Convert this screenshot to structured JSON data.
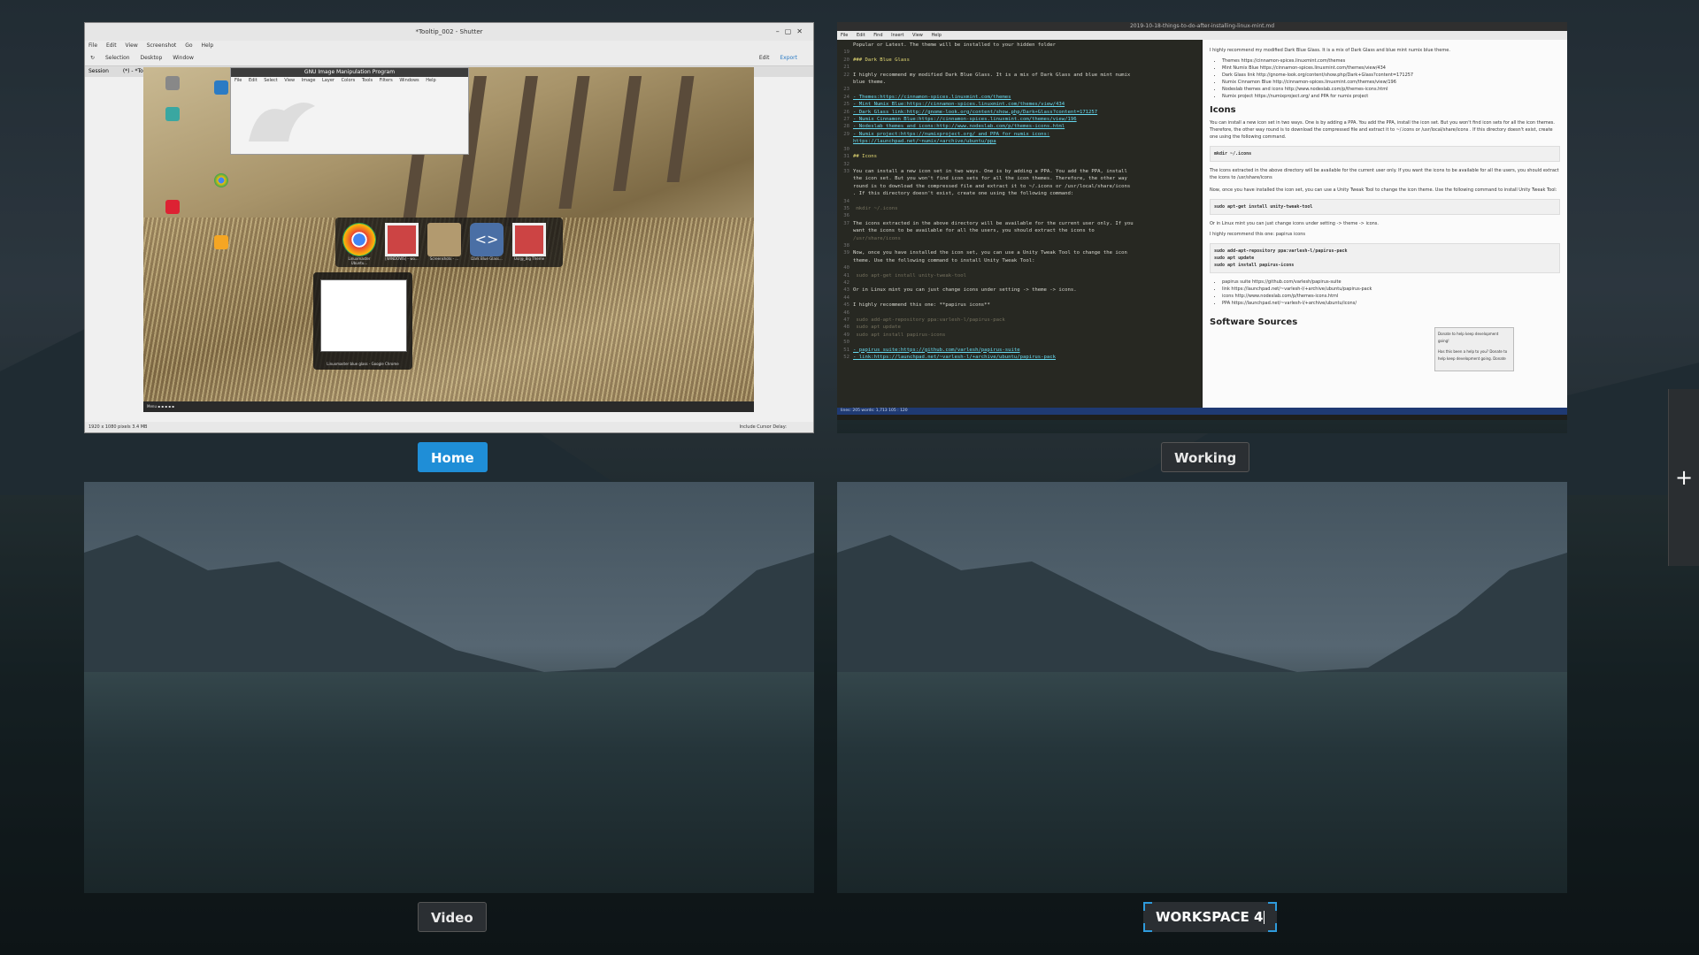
{
  "workspaces": [
    {
      "name": "Home",
      "active": true
    },
    {
      "name": "Working",
      "active": false
    },
    {
      "name": "Video",
      "active": false
    },
    {
      "name": "WORKSPACE 4",
      "active": false,
      "editing": true
    }
  ],
  "add_workspace": {
    "label": "+"
  },
  "shutter": {
    "title": "*Tooltip_002 - Shutter",
    "menu": [
      "File",
      "Edit",
      "View",
      "Screenshot",
      "Go",
      "Help"
    ],
    "toolbar": [
      "Selection",
      "Desktop",
      "Window"
    ],
    "toolbar_right": [
      "Edit",
      "Export"
    ],
    "tabs": [
      "Session",
      "(*) - *Tooltip_002"
    ],
    "status": "1920 x 1080 pixels  3.4 MB",
    "status_right": "Include Cursor  Delay:",
    "gimp_title": "GNU Image Manipulation Program",
    "gimp_menu": [
      "File",
      "Edit",
      "Select",
      "View",
      "Image",
      "Layer",
      "Colors",
      "Tools",
      "Filters",
      "Windows",
      "Help"
    ],
    "dock_items": [
      "Linuxmaster Ubuntu...",
      "[WINDOWS] - wo...",
      "Screenshots - ...",
      "Dark Blue Glass...",
      "Usr@_Big Theme"
    ],
    "preview_label": "Linuxmaster blue glass - Google Chrome"
  },
  "editor": {
    "title": "2019-10-18-things-to-do-after-installing-linux-mint.md",
    "menu": [
      "File",
      "Edit",
      "Find",
      "Insert",
      "View",
      "Help"
    ],
    "code_lines": [
      {
        "n": "",
        "t": "Popular or Latest. The theme will be installed to your hidden folder"
      },
      {
        "n": "19",
        "t": ""
      },
      {
        "n": "20",
        "t": "### Dark Blue Glass",
        "c": "h"
      },
      {
        "n": "21",
        "t": ""
      },
      {
        "n": "22",
        "t": "I highly recommend my modified Dark Blue Glass. It is a mix of Dark Glass and blue mint numix"
      },
      {
        "n": "",
        "t": "blue theme."
      },
      {
        "n": "23",
        "t": ""
      },
      {
        "n": "24",
        "t": "- Themes:https://cinnamon-spices.linuxmint.com/themes",
        "c": "lk"
      },
      {
        "n": "25",
        "t": "- Mint Numix Blue:https://cinnamon-spices.linuxmint.com/themes/view/434",
        "c": "lk"
      },
      {
        "n": "26",
        "t": "- Dark Glass link:http://gnome-look.org/content/show.php/Dark+Glass?content=171257",
        "c": "lk"
      },
      {
        "n": "27",
        "t": "- Numix Cinnamon Blue:https://cinnamon-spices.linuxmint.com/themes/view/196",
        "c": "lk"
      },
      {
        "n": "28",
        "t": "- Nodeslab themes and icons:http://www.nodeslab.com/p/themes-icons.html",
        "c": "lk"
      },
      {
        "n": "29",
        "t": "- Numix project:https://numixproject.org/ and PPA for numix icons:",
        "c": "lk"
      },
      {
        "n": "",
        "t": "https://launchpad.net/~numix/+archive/ubuntu/ppa",
        "c": "lk"
      },
      {
        "n": "30",
        "t": ""
      },
      {
        "n": "31",
        "t": "## Icons",
        "c": "h"
      },
      {
        "n": "32",
        "t": ""
      },
      {
        "n": "33",
        "t": "You can install a new icon set in two ways. One is by adding a PPA. You add the PPA, install"
      },
      {
        "n": "",
        "t": "the icon set. But you won't find icon sets for all the icon themes. Therefore, the other way"
      },
      {
        "n": "",
        "t": "round is to download the compressed file and extract it to ~/.icons or /usr/local/share/icons"
      },
      {
        "n": "",
        "t": ". If this directory doesn't exist, create one using the following command:"
      },
      {
        "n": "34",
        "t": ""
      },
      {
        "n": "35",
        "t": "    mkdir ~/.icons",
        "c": "cm"
      },
      {
        "n": "36",
        "t": ""
      },
      {
        "n": "37",
        "t": "The icons extracted in the above directory will be available for the current user only. If you"
      },
      {
        "n": "",
        "t": "want the icons to be available for all the users, you should extract the icons to"
      },
      {
        "n": "",
        "t": "/usr/share/icons",
        "c": "cm"
      },
      {
        "n": "38",
        "t": ""
      },
      {
        "n": "39",
        "t": "Now, once you have installed the icon set, you can use a Unity Tweak Tool to change the icon"
      },
      {
        "n": "",
        "t": "theme. Use the following command to install Unity Tweak Tool:"
      },
      {
        "n": "40",
        "t": ""
      },
      {
        "n": "41",
        "t": "    sudo apt-get install unity-tweak-tool",
        "c": "cm"
      },
      {
        "n": "42",
        "t": ""
      },
      {
        "n": "43",
        "t": "Or in Linux mint you can just change icons under setting -> theme -> icons."
      },
      {
        "n": "44",
        "t": ""
      },
      {
        "n": "45",
        "t": "I highly recommend this one: **papirus icons**"
      },
      {
        "n": "46",
        "t": ""
      },
      {
        "n": "47",
        "t": "    sudo add-apt-repository ppa:varlesh-l/papirus-pack",
        "c": "cm"
      },
      {
        "n": "48",
        "t": "    sudo apt update",
        "c": "cm"
      },
      {
        "n": "49",
        "t": "    sudo apt install papirus-icons",
        "c": "cm"
      },
      {
        "n": "50",
        "t": ""
      },
      {
        "n": "51",
        "t": "- papirus suite:https://github.com/varlesh/papirus-suite",
        "c": "lk"
      },
      {
        "n": "52",
        "t": "- link:https://launchpad.net/~varlesh-l/+archive/ubuntu/papirus-pack",
        "c": "lk"
      }
    ],
    "preview": {
      "intro": "I highly recommend my modified Dark Blue Glass. It is a mix of Dark Glass and blue mint numix blue theme.",
      "list": [
        "Themes https://cinnamon-spices.linuxmint.com/themes",
        "Mint Numix Blue https://cinnamon-spices.linuxmint.com/themes/view/434",
        "Dark Glass link http://gnome-look.org/content/show.php/Dark+Glass?content=171257",
        "Numix Cinnamon Blue http://cinnamon-spices.linuxmint.com/themes/view/196",
        "Nodeslab themes and icons http://www.nodeslab.com/p/themes-icons.html",
        "Numix project https://numixproject.org/ and PPA for numix project"
      ],
      "icons_heading": "Icons",
      "icons_text": "You can install a new icon set in two ways. One is by adding a PPA. You add the PPA, install the icon set. But you won't find icon sets for all the icon themes. Therefore, the other way round is to download the compressed file and extract it to ~/.icons or /usr/local/share/icons . If this directory doesn't exist, create one using the following command.",
      "code1": "mkdir ~/.icons",
      "text2": "The icons extracted in the above directory will be available for the current user only. If you want the icons to be available for all the users, you should extract the icons to /usr/share/icons",
      "text3": "Now, once you have installed the icon set, you can use a Unity Tweak Tool to change the icon theme. Use the following command to install Unity Tweak Tool:",
      "code2": "sudo apt-get install unity-tweak-tool",
      "text4": "Or in Linux mint you can just change icons under setting -> theme -> icons.",
      "text5": "I highly recommend this one: papirus icons",
      "code3": [
        "sudo add-apt-repository ppa:varlesh-l/papirus-pack",
        "sudo apt update",
        "sudo apt install papirus-icons"
      ],
      "list2": [
        "papirus suite https://github.com/varlesh/papirus-suite",
        "link https://launchpad.net/~varlesh-l/+archive/ubuntu/papirus-pack",
        "icons http://www.nodeslab.com/p/themes-icons.html",
        "PPA https://launchpad.net/~varlesh-l/+archive/ubuntu/icons/"
      ],
      "donate_title": "Donate to help keep development going!",
      "donate_text": "Has this been a help to you? Donate to help keep development going. Donate",
      "software_heading": "Software Sources"
    },
    "status": "lines: 205  words: 1,713  105 : 120"
  }
}
